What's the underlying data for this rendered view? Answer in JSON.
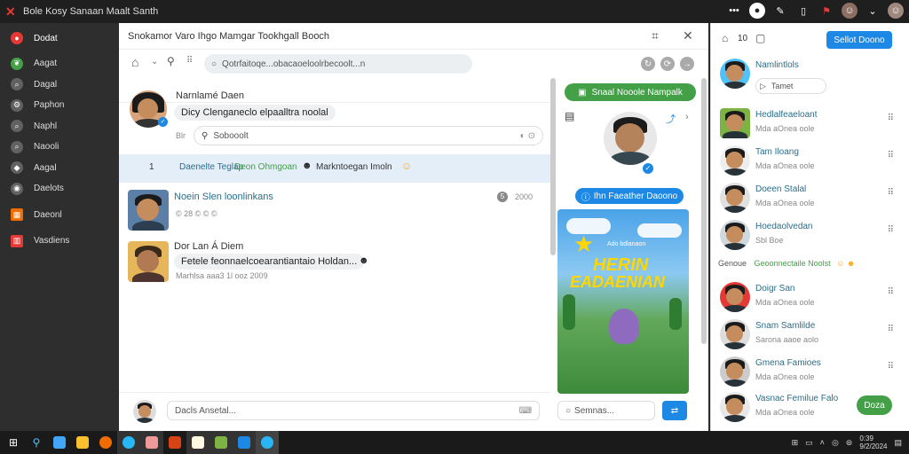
{
  "topbar": {
    "title": "Bole Kosy Sanaan Maalt Santh",
    "icons": [
      "more-icon",
      "avatar-icon",
      "pen-icon",
      "bookmark-icon",
      "flag-icon",
      "profile-icon",
      "chevron-down-icon",
      "user-avatar-icon"
    ]
  },
  "sidebar": {
    "items": [
      {
        "label": "Dodat",
        "icon": "home-icon",
        "color": "#e53935"
      },
      {
        "label": "Aagat",
        "icon": "leaf-icon",
        "color": "#43a047"
      },
      {
        "label": "Dagal",
        "icon": "search-icon",
        "color": "#757575"
      },
      {
        "label": "Paphon",
        "icon": "gear-icon",
        "color": "#757575"
      },
      {
        "label": "Naphl",
        "icon": "search-icon",
        "color": "#757575"
      },
      {
        "label": "Naooli",
        "icon": "search-icon",
        "color": "#757575"
      },
      {
        "label": "Aagal",
        "icon": "gamepad-icon",
        "color": "#757575"
      },
      {
        "label": "Daelots",
        "icon": "circle-icon",
        "color": "#757575"
      },
      {
        "label": "Daeonl",
        "icon": "grid-icon",
        "color": "#ef6c00"
      },
      {
        "label": "Vasdiens",
        "icon": "chart-icon",
        "color": "#e53935"
      }
    ]
  },
  "window": {
    "title": "Snokamor Varo Ihgo Mamgar Tookhgall Booch",
    "search_placeholder": "Qotrfaitoqe...obacaoeloolrbecoolt...n",
    "messages": [
      {
        "name": "Narnlamé Daen",
        "text": "Dicy Clenganeclo elpaalltra noolal",
        "meta": "Blr"
      },
      {
        "name": "Noein Slen loonlinkans",
        "meta": "© 28 © © ©",
        "time": "2000"
      },
      {
        "name": "Dor Lan Á Diem",
        "text": "Fetele feonnaelcoearantiantaio Holdan...",
        "meta": "Marhlsa aaa3 1l ooz 2009"
      }
    ],
    "reply_search": "Sobooolt",
    "highlight": {
      "num": "1",
      "a": "Daenelte Teglap",
      "b": "Deon Ohmgoan",
      "c": "Markntoegan Imoln"
    },
    "compose_placeholder": "Dacls Ansetal...",
    "right": {
      "top_button": "Snaal Nooole Nampalk",
      "follow_button": "Ihn Faeather Daoono",
      "card_title_1": "HERIN",
      "card_title_2": "EADAENIAN",
      "card_subtitle": "Ado bdlanaon",
      "input_placeholder": "Semnas..."
    }
  },
  "contacts": {
    "count": "10",
    "top_button": "Sellot Doono",
    "section_label": "Genoue",
    "section_link": "Geoonnectaile Noolst",
    "action_button": "Doza",
    "items": [
      {
        "name": "Namlintlols",
        "status": "Tamet",
        "special": true
      },
      {
        "name": "Hedlalfeaeloant",
        "status": "Mda aOnea oole"
      },
      {
        "name": "Tam Iloang",
        "status": "Mda aOnea oole"
      },
      {
        "name": "Doeen Stalal",
        "status": "Mda aOnea oole"
      },
      {
        "name": "Hoedaolvedan",
        "status": "Sbl Boe"
      },
      {
        "name": "Doigr San",
        "status": "Mda aOnea oole"
      },
      {
        "name": "Snam Samlilde",
        "status": "Sarona aaoe aolo"
      },
      {
        "name": "Gmena Famioes",
        "status": "Mda aOnea oole"
      },
      {
        "name": "Vasnac Femilue Falo",
        "status": "Mda aOnea oole"
      }
    ]
  },
  "taskbar": {
    "clock_time": "0:39",
    "clock_date": "9/2/2024"
  },
  "colors": {
    "accent": "#1e88e5",
    "green": "#43a047"
  }
}
